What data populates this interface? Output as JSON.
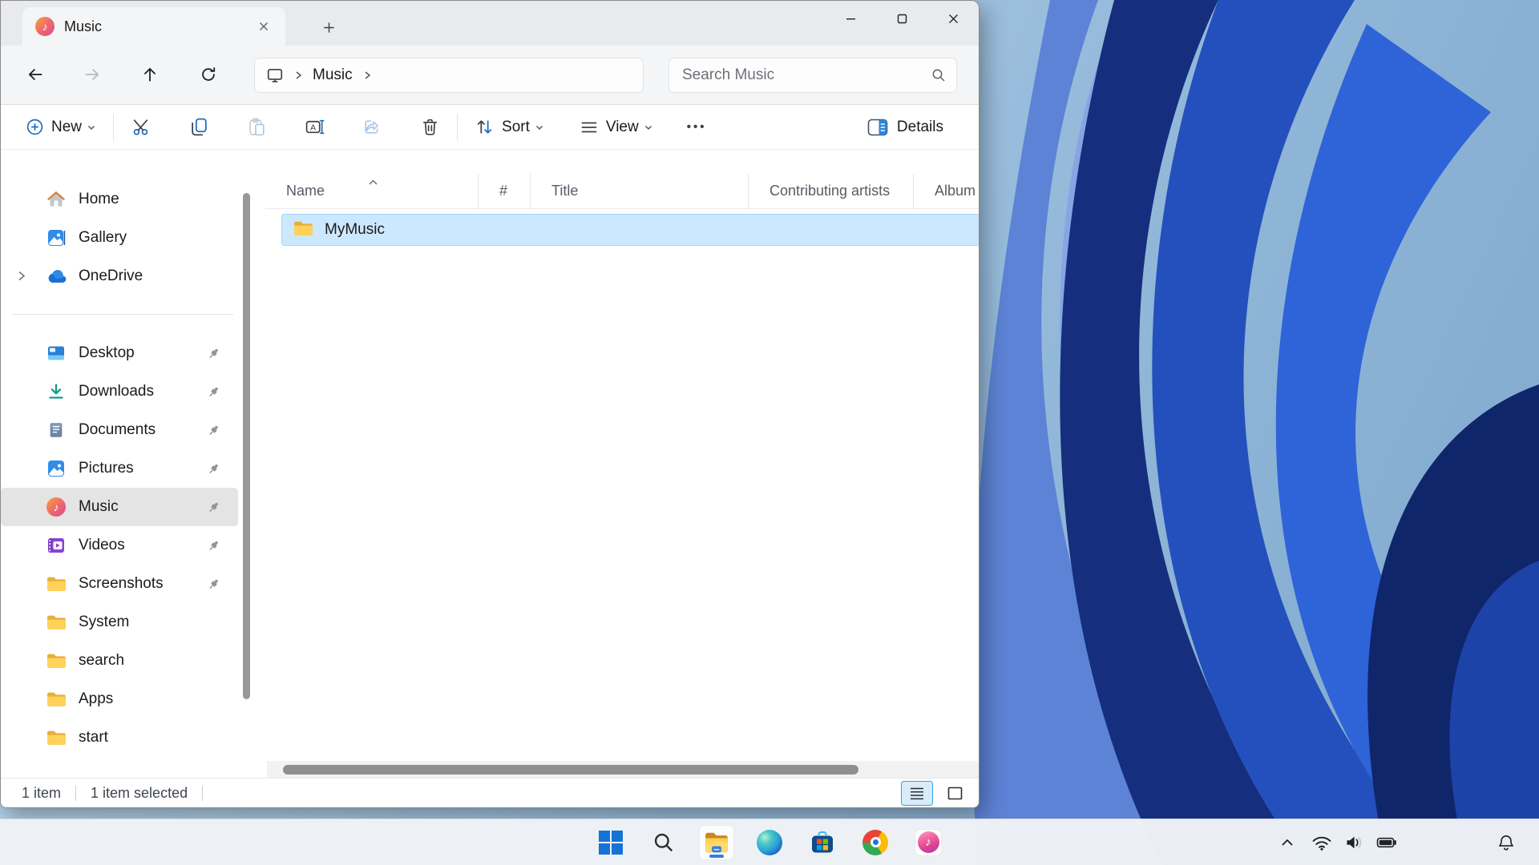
{
  "window": {
    "tab": {
      "title": "Music"
    },
    "controls": {
      "minimize": "minimize",
      "maximize": "maximize",
      "close": "close"
    },
    "nav": {
      "breadcrumb_root": "this-pc",
      "breadcrumb": [
        "Music"
      ],
      "search_placeholder": "Search Music"
    },
    "toolbar": {
      "new": "New",
      "sort": "Sort",
      "view": "View",
      "more": "•••",
      "details": "Details",
      "icon_actions": [
        "cut",
        "copy",
        "paste",
        "rename",
        "share",
        "delete"
      ]
    },
    "sidebar": {
      "items": [
        {
          "label": "Home",
          "icon": "home-icon"
        },
        {
          "label": "Gallery",
          "icon": "gallery-icon"
        },
        {
          "label": "OneDrive",
          "icon": "onedrive-icon",
          "expandable": true
        },
        {
          "label": "Desktop",
          "icon": "desktop-icon",
          "pinned": true
        },
        {
          "label": "Downloads",
          "icon": "downloads-icon",
          "pinned": true
        },
        {
          "label": "Documents",
          "icon": "documents-icon",
          "pinned": true
        },
        {
          "label": "Pictures",
          "icon": "pictures-icon",
          "pinned": true
        },
        {
          "label": "Music",
          "icon": "music-icon",
          "pinned": true,
          "selected": true
        },
        {
          "label": "Videos",
          "icon": "videos-icon",
          "pinned": true
        },
        {
          "label": "Screenshots",
          "icon": "folder-icon",
          "pinned": true
        },
        {
          "label": "System",
          "icon": "folder-icon"
        },
        {
          "label": "search",
          "icon": "folder-icon"
        },
        {
          "label": "Apps",
          "icon": "folder-icon"
        },
        {
          "label": "start",
          "icon": "folder-icon"
        }
      ]
    },
    "columns": [
      "Name",
      "#",
      "Title",
      "Contributing artists",
      "Album"
    ],
    "sort": {
      "column": "Name",
      "direction": "ascending"
    },
    "files": [
      {
        "name": "MyMusic",
        "icon": "folder-icon",
        "selected": true
      }
    ],
    "statusbar": {
      "count": "1 item",
      "selected": "1 item selected"
    }
  },
  "taskbar": {
    "apps": [
      "start",
      "search",
      "file-explorer",
      "edge",
      "microsoft-store",
      "chrome",
      "itunes"
    ],
    "active_app": "file-explorer",
    "tray_icons": [
      "chevron-up",
      "wifi",
      "volume",
      "battery"
    ],
    "notification_icon": "bell"
  },
  "colors": {
    "accent": "#1b6ec2",
    "selection_bg": "#cce8ff",
    "sidebar_selected_bg": "#e4e4e4",
    "folder_yellow": "#ffd259",
    "taskbar_bg": "#eff2f6",
    "chrome_bg": "#e8eaed"
  }
}
